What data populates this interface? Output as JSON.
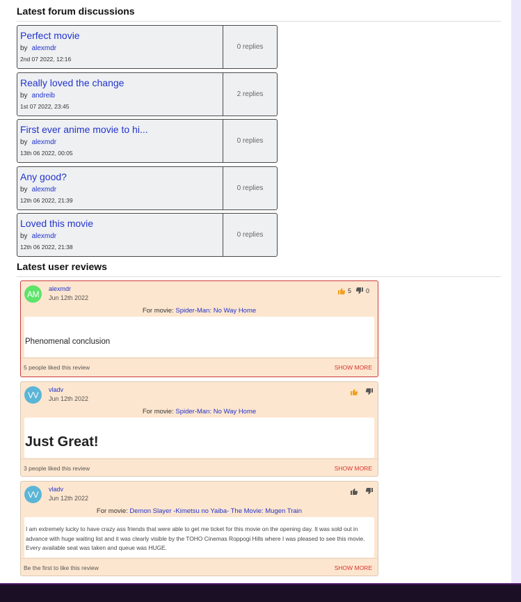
{
  "forum": {
    "title": "Latest forum discussions",
    "items": [
      {
        "title": "Perfect movie",
        "by": "by",
        "user": "alexmdr",
        "date": "2nd 07 2022, 12:16",
        "replies": "0 replies"
      },
      {
        "title": "Really loved the change",
        "by": "by",
        "user": "andreib",
        "date": "1st 07 2022, 23:45",
        "replies": "2 replies"
      },
      {
        "title": "First ever anime movie to hi...",
        "by": "by",
        "user": "alexmdr",
        "date": "13th 06 2022, 00:05",
        "replies": "0 replies"
      },
      {
        "title": "Any good?",
        "by": "by",
        "user": "alexmdr",
        "date": "12th 06 2022, 21:39",
        "replies": "0 replies"
      },
      {
        "title": "Loved this movie",
        "by": "by",
        "user": "alexmdr",
        "date": "12th 06 2022, 21:38",
        "replies": "0 replies"
      }
    ]
  },
  "reviews": {
    "title": "Latest user reviews",
    "items": [
      {
        "initials": "AM",
        "avatar_color": "#5ee36b",
        "user": "alexmdr",
        "date": "Jun 12th 2022",
        "likes": "5",
        "dislikes": "0",
        "movie_prefix": "For movie:",
        "movie": "Spider-Man: No Way Home",
        "body": "Phenomenal conclusion",
        "footer": "5 people liked this review",
        "show_more": "SHOW MORE",
        "like_icon": "thumbs-up-icon",
        "dislike_icon": "thumbs-down-icon"
      },
      {
        "initials": "VV",
        "avatar_color": "#5bb5d6",
        "user": "vladv",
        "date": "Jun 12th 2022",
        "movie_prefix": "For movie:",
        "movie": "Spider-Man: No Way Home",
        "body": "Just Great!",
        "footer": "3 people liked this review",
        "show_more": "SHOW MORE",
        "like_icon": "thumbs-up-icon",
        "dislike_icon": "thumbs-down-icon"
      },
      {
        "initials": "VV",
        "avatar_color": "#5bb5d6",
        "user": "vladv",
        "date": "Jun 12th 2022",
        "movie_prefix": "For movie:",
        "movie": "Demon Slayer -Kimetsu no Yaiba- The Movie: Mugen Train",
        "body": "I am extremely lucky to have crazy ass friends that were able to get me ticket for this movie on the opening day. It was sold out in advance with huge waiting list and it was clearly visible by the TOHO Cinemas Roppogi Hills where I was pleased to see this movie. Every available seat was taken and queue was HUGE.",
        "footer": "Be the first to like this review",
        "show_more": "SHOW MORE",
        "like_icon": "thumbs-up-icon",
        "dislike_icon": "thumbs-down-icon"
      }
    ]
  },
  "colors": {
    "link": "#2233cc",
    "like_active": "#f0a020",
    "like_inactive": "#555555",
    "card_bg": "#fde6cf",
    "highlight_border": "#c93a3a"
  }
}
